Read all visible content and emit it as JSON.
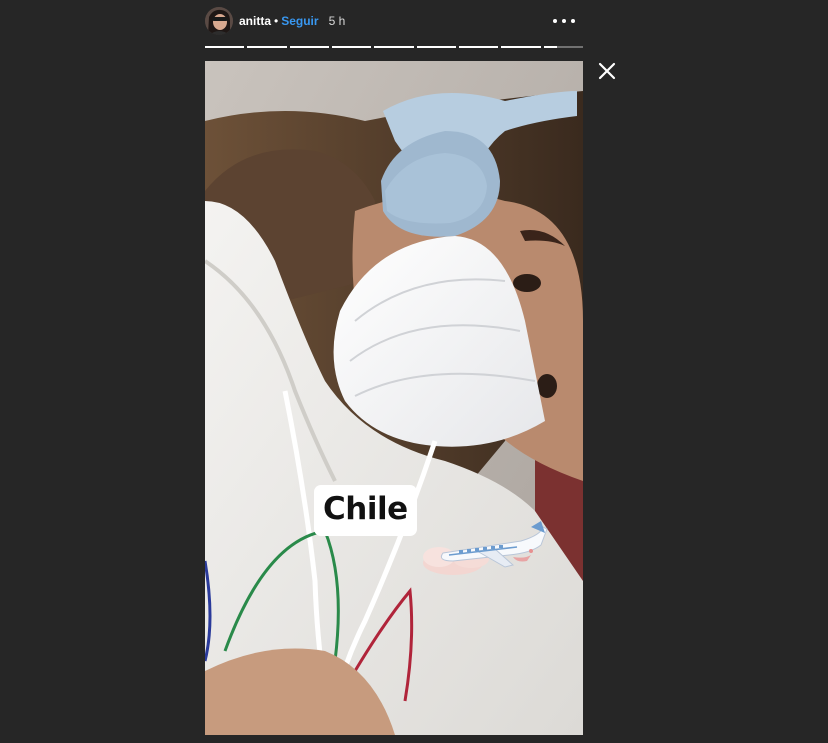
{
  "story_header": {
    "username": "anitta",
    "separator": "•",
    "follow_label": "Seguir",
    "time_ago": "5 h"
  },
  "progress": {
    "segments_total": 9,
    "segments_seen": 8,
    "current_fraction": 0.35
  },
  "story": {
    "text_sticker": "Chile",
    "icons": {
      "more": "more-options-icon",
      "close": "close-icon",
      "plane_sticker": "airplane-sticker"
    }
  },
  "colors": {
    "background": "#262626",
    "follow_link": "#3897f0",
    "text": "#ffffff"
  }
}
